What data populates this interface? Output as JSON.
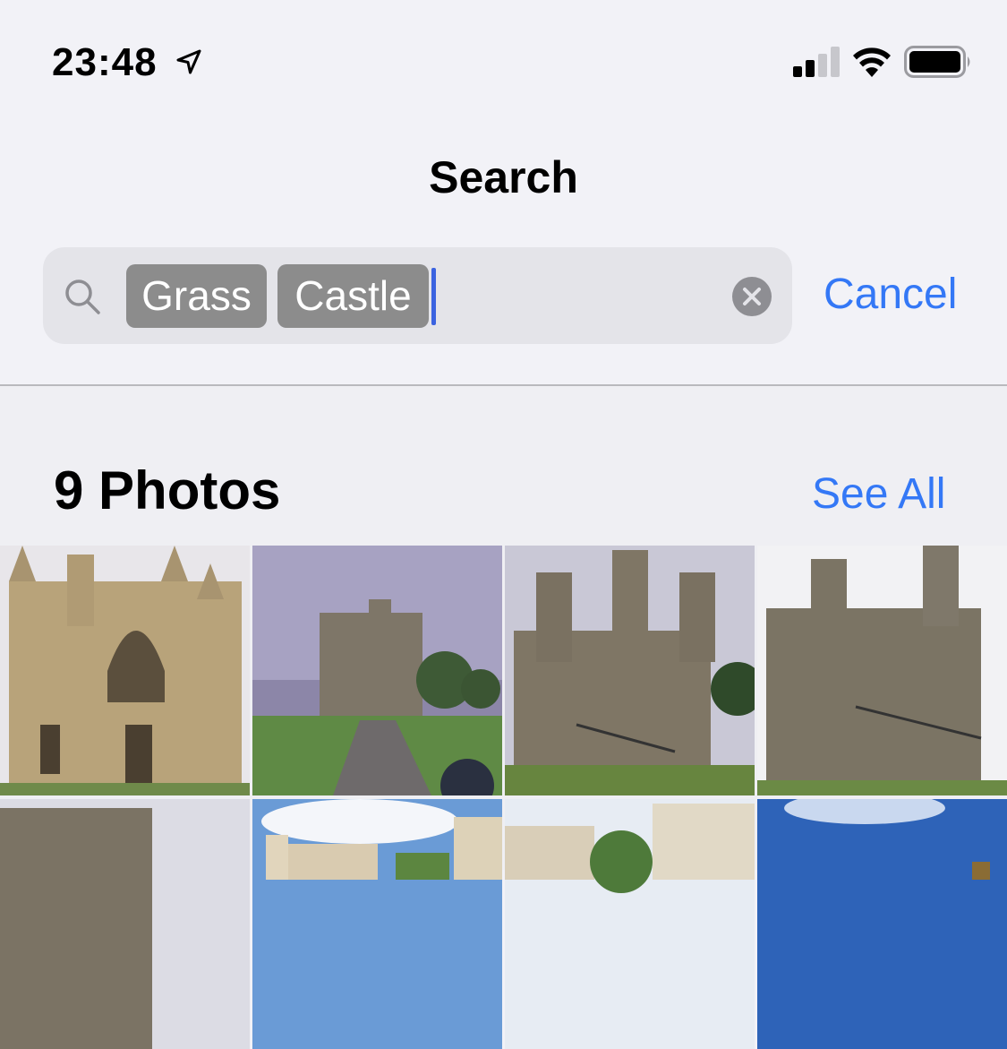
{
  "status_bar": {
    "time": "23:48",
    "icons": [
      "location-arrow-icon",
      "cellular-signal-icon",
      "wifi-icon",
      "battery-icon"
    ]
  },
  "nav": {
    "title": "Search"
  },
  "search": {
    "tokens": [
      "Grass",
      "Castle"
    ],
    "icon": "search-icon",
    "clear_icon": "clear-icon",
    "cancel_label": "Cancel"
  },
  "results": {
    "section_title": "9 Photos",
    "see_all_label": "See All"
  },
  "colors": {
    "accent": "#3478f6",
    "token_bg": "#8c8c8c",
    "caret": "#3b63e0",
    "background": "#f2f2f7"
  }
}
